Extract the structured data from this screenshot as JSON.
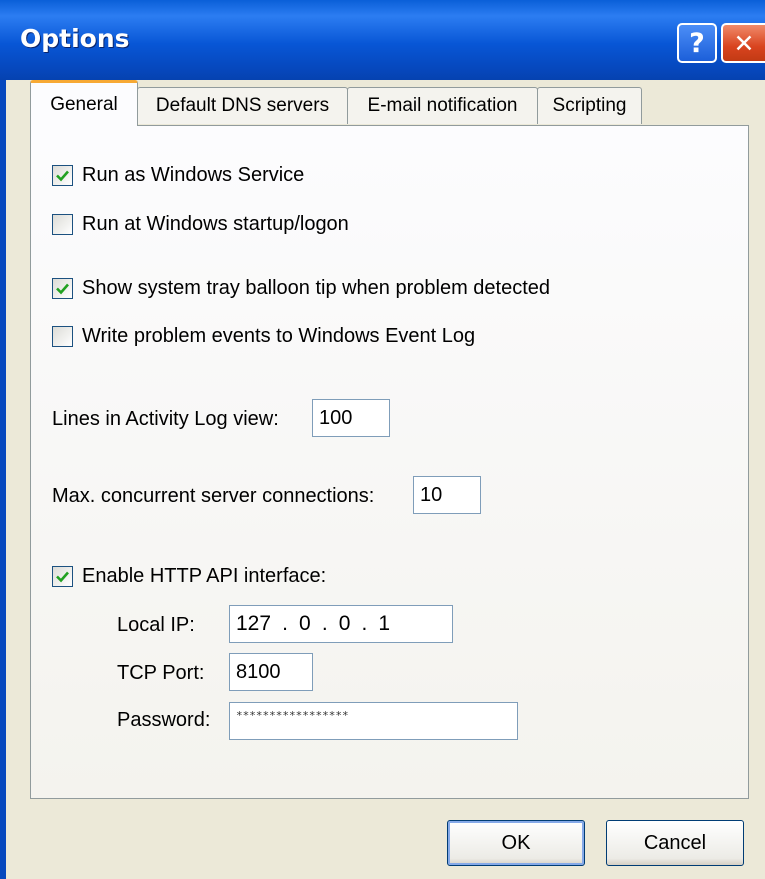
{
  "window": {
    "title": "Options",
    "help_glyph": "?",
    "close_glyph": "✕"
  },
  "tabs": [
    {
      "label": "General",
      "active": true
    },
    {
      "label": "Default DNS servers",
      "active": false
    },
    {
      "label": "E-mail notification",
      "active": false
    },
    {
      "label": "Scripting",
      "active": false
    }
  ],
  "general": {
    "run_as_service": {
      "label": "Run as Windows Service",
      "checked": true
    },
    "run_at_startup": {
      "label": "Run at Windows startup/logon",
      "checked": false
    },
    "show_balloon": {
      "label": "Show system tray balloon tip when problem detected",
      "checked": true
    },
    "write_event_log": {
      "label": "Write problem events to Windows Event Log",
      "checked": false
    },
    "activity_lines": {
      "label": "Lines in Activity Log view:",
      "value": "100"
    },
    "max_connections": {
      "label": "Max. concurrent server connections:",
      "value": "10"
    },
    "http_api": {
      "label": "Enable HTTP API interface:",
      "checked": true
    },
    "local_ip": {
      "label": "Local IP:",
      "octets": [
        "127",
        "0",
        "0",
        "1"
      ],
      "separator": "."
    },
    "tcp_port": {
      "label": "TCP Port:",
      "value": "8100"
    },
    "password": {
      "label": "Password:",
      "value": "*****************"
    }
  },
  "buttons": {
    "ok": "OK",
    "cancel": "Cancel"
  },
  "colors": {
    "titlebar": "#0856d6",
    "dialog_bg": "#ece9d8",
    "tab_accent": "#f7a934",
    "checkmark": "#21a121",
    "close_button": "#d9441f"
  }
}
